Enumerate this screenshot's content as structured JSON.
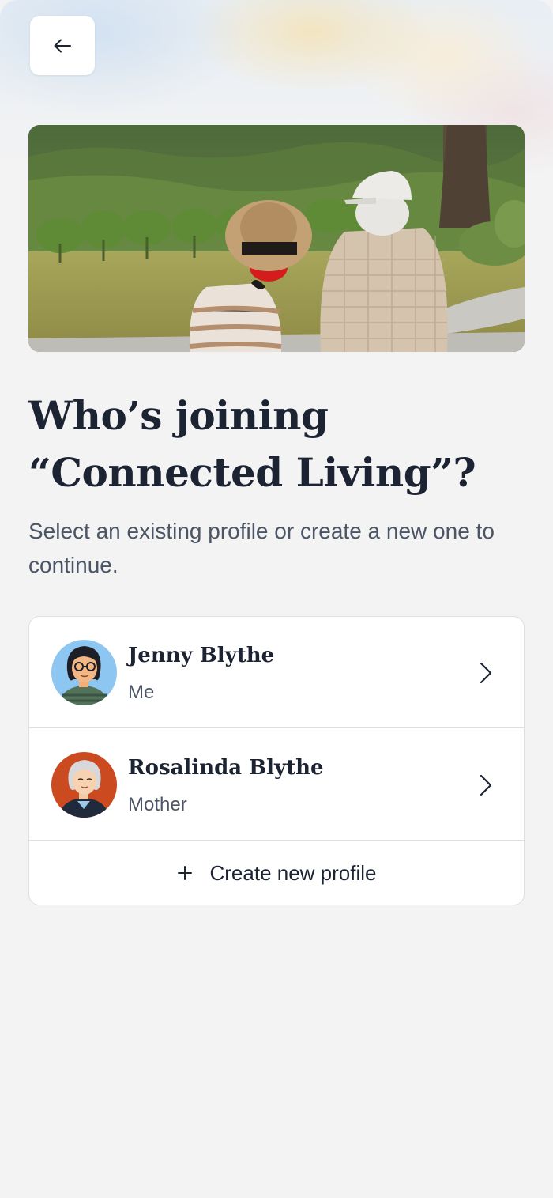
{
  "nav": {
    "back_icon": "arrow-left-icon"
  },
  "hero": {
    "image": "elderly-couple-vineyard-photo"
  },
  "headline": {
    "line1": "Who’s joining",
    "line2": "“Connected Living”?"
  },
  "subtitle": "Select an existing profile or create a new one to continue.",
  "profiles": [
    {
      "name": "Jenny Blythe",
      "relation": "Me",
      "avatar_color": "#8ec6f2"
    },
    {
      "name": "Rosalinda Blythe",
      "relation": "Mother",
      "avatar_color": "#cc4a1f"
    }
  ],
  "create": {
    "label": "Create new profile",
    "icon": "plus-icon"
  },
  "colors": {
    "background": "#f3f3f3",
    "heading": "#1c2433",
    "body_text": "#4b5565",
    "divider": "#dcdfe3"
  }
}
